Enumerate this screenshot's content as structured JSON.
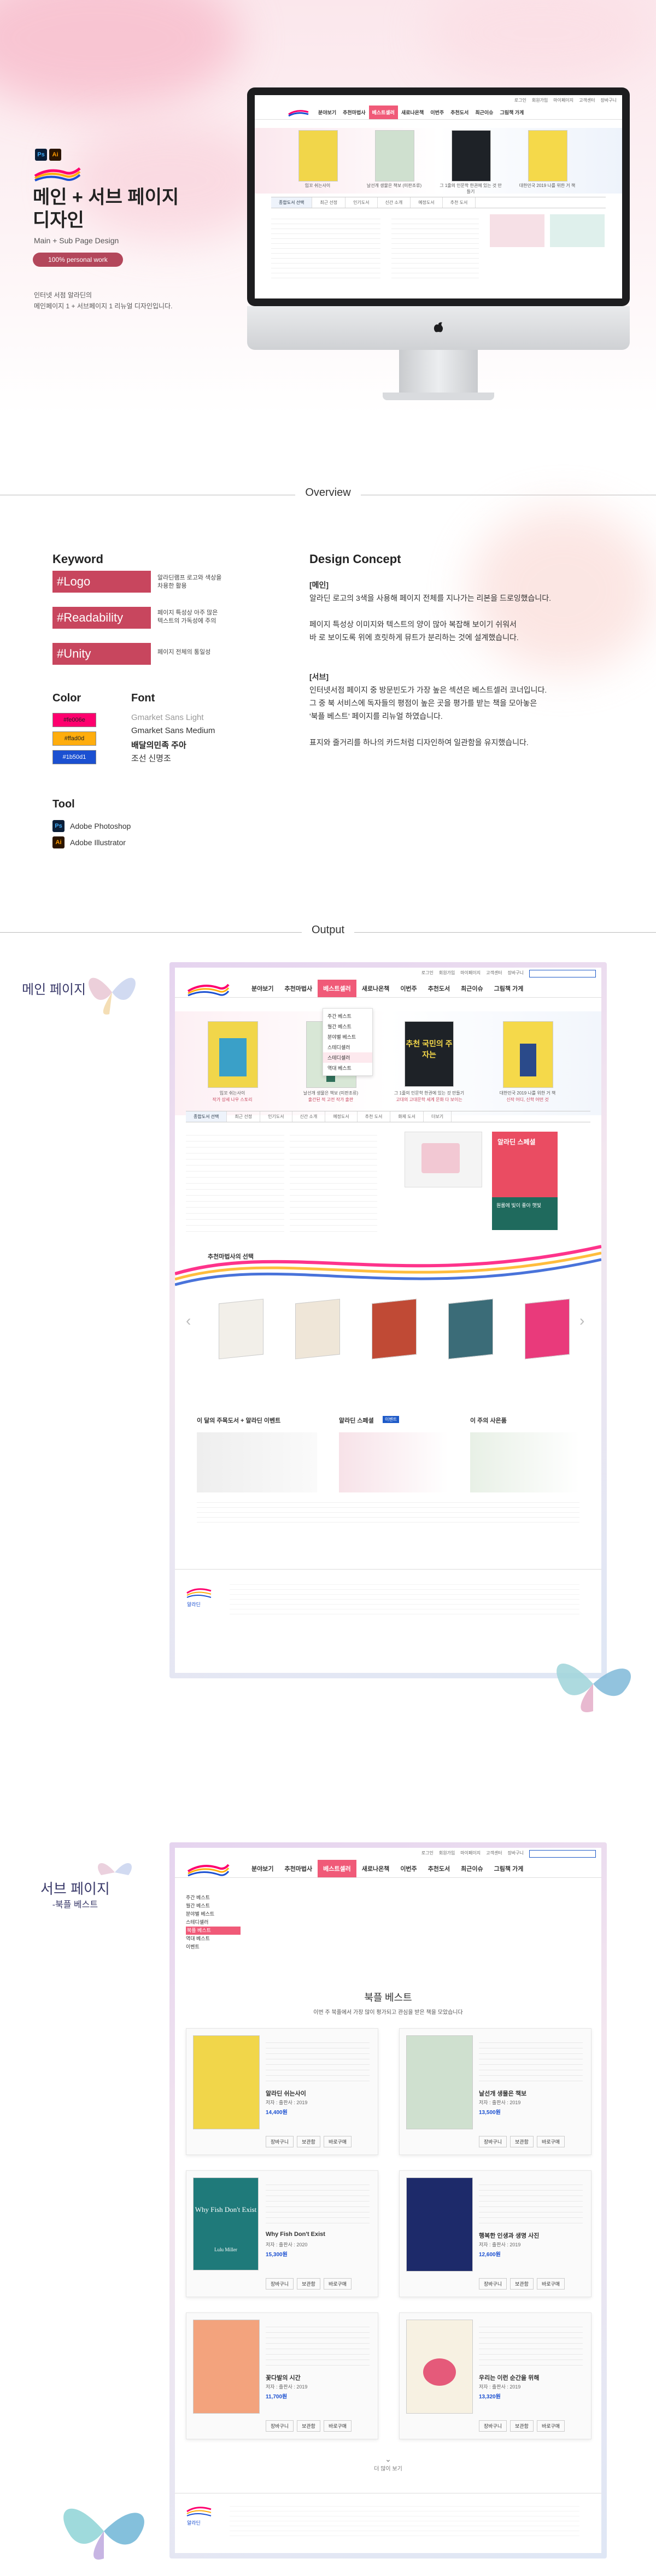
{
  "hero": {
    "tools": [
      "Ps",
      "Ai"
    ],
    "title_line1": "메인 + 서브 페이지",
    "title_line2": "디자인",
    "subtitle": "Main + Sub Page Design",
    "badge": "100% personal work",
    "desc_line1": "인터넷 서점 알라딘의",
    "desc_line2": "메인페이지 1 + 서브페이지 1 리뉴얼 디자인입니다."
  },
  "site": {
    "nav": [
      "분야보기",
      "추천마법사",
      "베스트셀러",
      "새로나온책",
      "이번주",
      "추천도서",
      "최근이슈",
      "그림책 가게"
    ],
    "active_nav": "베스트셀러",
    "topbar": [
      "로그인",
      "회원가입",
      "마이페이지",
      "고객센터",
      "장바구니"
    ],
    "main_books": [
      {
        "caption": "입꼬 쉬는사이",
        "sub": "작가 상세 나우 스토리"
      },
      {
        "caption": "날선개 생물은 책보 (미판조류)",
        "sub": "출간된 적 고전 작가 출판"
      },
      {
        "caption": "그 1줄의 인문학 한권에 있는 것 만들기",
        "sub": "고대의 고대문학 세계 문화 다 보이는"
      },
      {
        "caption": "대한민국 2019 나를 위한 거 책",
        "sub": "신작 어디, 신학 어떤 것"
      }
    ],
    "tabs": [
      "종합도서 선택",
      "최근 선정",
      "인기도서",
      "신간 소개",
      "예정도서",
      "추천 도서",
      "화제 도서",
      "더보기"
    ],
    "dropdown": [
      "주간 베스트",
      "월간 베스트",
      "분야별 베스트",
      "스테디셀러",
      "스테디셀러",
      "역대 베스트"
    ],
    "recommend_title": "추천마법사의 선택",
    "section_titles": [
      "이 달의 주목도서 + 알라딘 이벤트",
      "알라딘 스페셜",
      "이 주의 사은품"
    ],
    "special_tag": "이벤트",
    "footer_logo": "알라딘",
    "banner": "알라딘 스페셜",
    "banner_sub": "원룸에 빛이 좋아 햇빛"
  },
  "overview": {
    "section_title": "Overview",
    "keyword_title": "Keyword",
    "keywords": [
      {
        "tag": "#Logo",
        "desc": "알라딘램프 로고와 색상을차용한 활용"
      },
      {
        "tag": "#Readability",
        "desc": "페이지 특성상 아주 많은 텍스트의 가독성에 주의"
      },
      {
        "tag": "#Unity",
        "desc": "페이지 전체의 통일성"
      }
    ],
    "color_title": "Color",
    "colors": [
      {
        "label": "#fe006e",
        "hex": "#fe006e"
      },
      {
        "label": "#ffad0d",
        "hex": "#ffad0d"
      },
      {
        "label": "#1b50d1",
        "hex": "#1b50d1"
      }
    ],
    "font_title": "Font",
    "fonts": [
      "Gmarket Sans Light",
      "Gmarket Sans Medium",
      "배달의민족 주아",
      "조선 신명조"
    ],
    "tool_title": "Tool",
    "tools": [
      {
        "badge": "Ps",
        "name": "Adobe Photoshop"
      },
      {
        "badge": "Ai",
        "name": "Adobe Illustrator"
      }
    ],
    "concept_title": "Design Concept",
    "main_label": "[메인]",
    "main_text": [
      "알라딘 로고의 3색을 사용해 페이지 전체를 지나가는 리본을 드로잉했습니다.",
      "",
      "페이지 특성상 이미지와 텍스트의 양이 많아 복잡해 보이기 쉬워서",
      "바 로 보이도록 위에 흐릿하게 뮤트가 분리하는 것에 설계했습니다."
    ],
    "sub_label": "[서브]",
    "sub_text": [
      "인터넷서점 페이지 중 방문빈도가 가장 높은 섹션은 베스트셀러 코너입니다.",
      "그 중 북 서비스에 독자들의 평점이 높은 곳을 평가를 받는 책을 모아놓은",
      "'북플 베스트' 페이지를 리뉴얼 하였습니다.",
      "",
      "표지와 줄거리를 하나의 카드처럼 디자인하여 일관함을 유지했습니다."
    ]
  },
  "output": {
    "section_title": "Output",
    "main_label": "메인 페이지",
    "sub_label_line1": "서브 페이지",
    "sub_label_line2": "-북플 베스트",
    "sub_page_title": "북플 베스트",
    "sub_page_desc": "이번 주 북플에서 가장 많이 평가되고 관심을 받은 책을 모았습니다",
    "sub_sidebar": [
      "주간 베스트",
      "월간 베스트",
      "분야별 베스트",
      "스테디셀러",
      "북플 베스트",
      "역대 베스트",
      "이벤트"
    ],
    "sub_books": [
      {
        "title": "알라딘 쉬는사이",
        "meta": "저자 : 출판사 : 2019",
        "price": "14,400원"
      },
      {
        "title": "날선개 생물은 책보",
        "meta": "저자 : 출판사 : 2019",
        "price": "13,500원"
      },
      {
        "title": "Why Fish Don't Exist",
        "meta": "저자 : 출판사 : 2020",
        "price": "15,300원"
      },
      {
        "title": "행복한 인생과 생명 사진",
        "meta": "저자 : 출판사 : 2019",
        "price": "12,600원"
      },
      {
        "title": "꽃다발의 시간",
        "meta": "저자 : 출판사 : 2019",
        "price": "11,700원"
      },
      {
        "title": "우리는 이런 순간을 위해",
        "meta": "저자 : 출판사 : 2019",
        "price": "13,320원"
      }
    ],
    "card_buttons": [
      "장바구니",
      "보관함",
      "바로구매"
    ],
    "more": "더 많이 보기",
    "book_cover_texts": [
      "추천 국민의 주자는",
      "Why Fish Don't Exist",
      "Lulu Miller"
    ]
  },
  "accent": {
    "pink": "#fe006e",
    "orange": "#ffad0d",
    "blue": "#1b50d1",
    "badge": "#c8465e"
  }
}
